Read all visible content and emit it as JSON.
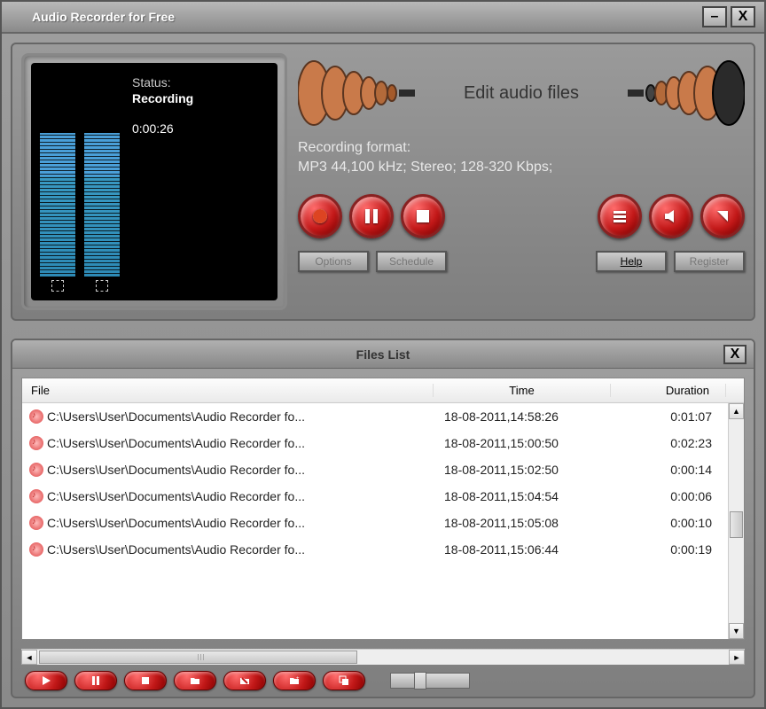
{
  "window": {
    "title": "Audio Recorder for Free"
  },
  "status": {
    "label": "Status:",
    "value": "Recording",
    "elapsed": "0:00:26"
  },
  "edit_label": "Edit audio files",
  "format": {
    "label": "Recording format:",
    "value": "MP3 44,100 kHz; Stereo;  128-320 Kbps;"
  },
  "buttons": {
    "options": "Options",
    "schedule": "Schedule",
    "help": "Help",
    "register": "Register"
  },
  "files": {
    "title": "Files List",
    "columns": {
      "file": "File",
      "time": "Time",
      "duration": "Duration"
    },
    "rows": [
      {
        "file": "C:\\Users\\User\\Documents\\Audio Recorder fo...",
        "time": "18-08-2011,14:58:26",
        "duration": "0:01:07"
      },
      {
        "file": "C:\\Users\\User\\Documents\\Audio Recorder fo...",
        "time": "18-08-2011,15:00:50",
        "duration": "0:02:23"
      },
      {
        "file": "C:\\Users\\User\\Documents\\Audio Recorder fo...",
        "time": "18-08-2011,15:02:50",
        "duration": "0:00:14"
      },
      {
        "file": "C:\\Users\\User\\Documents\\Audio Recorder fo...",
        "time": "18-08-2011,15:04:54",
        "duration": "0:00:06"
      },
      {
        "file": "C:\\Users\\User\\Documents\\Audio Recorder fo...",
        "time": "18-08-2011,15:05:08",
        "duration": "0:00:10"
      },
      {
        "file": "C:\\Users\\User\\Documents\\Audio Recorder fo...",
        "time": "18-08-2011,15:06:44",
        "duration": "0:00:19"
      }
    ]
  }
}
